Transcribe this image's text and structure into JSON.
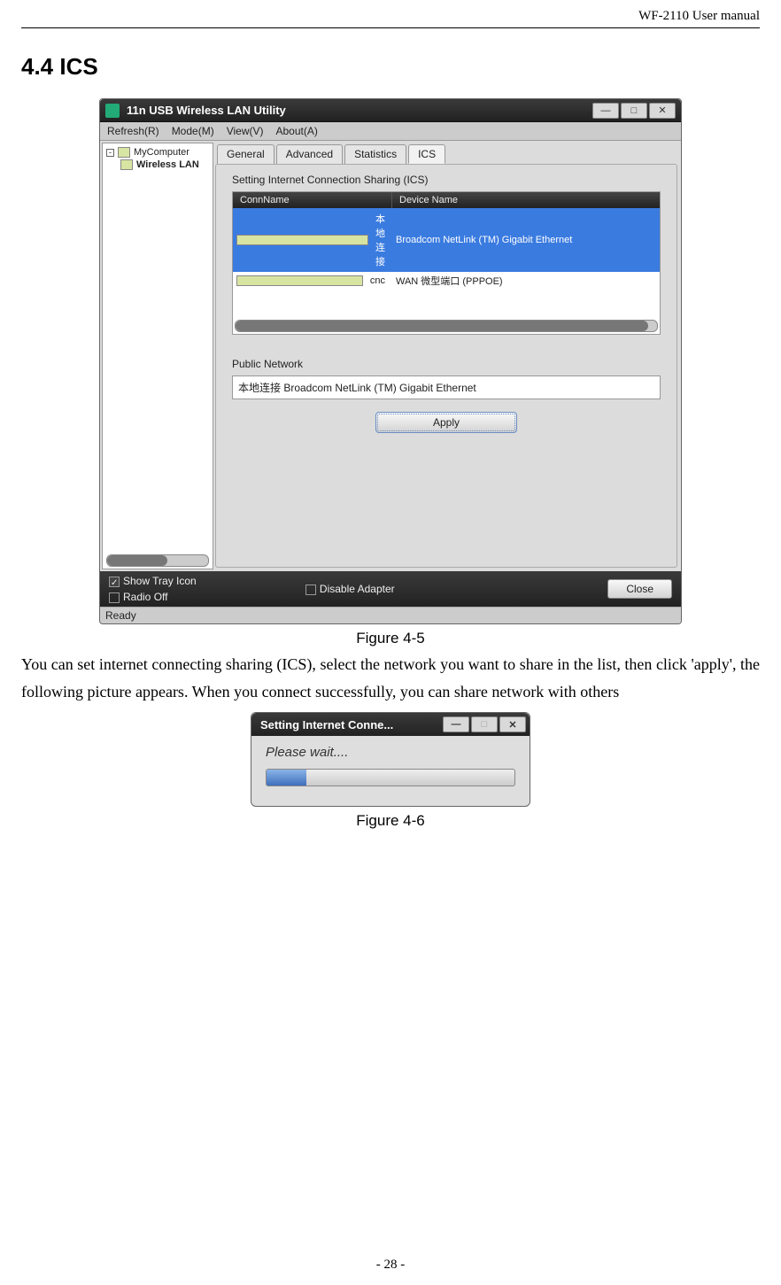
{
  "doc": {
    "header": "WF-2110 User manual",
    "section_heading": "4.4  ICS",
    "fig1_caption": "Figure 4-5",
    "body_paragraph": "You can set internet connecting sharing (ICS), select the network you want to share in the list, then click 'apply', the following picture appears. When you connect successfully, you can share network with others",
    "fig2_caption": "Figure 4-6",
    "page_number": "- 28 -"
  },
  "fig1": {
    "title": "11n USB Wireless LAN Utility",
    "menus": [
      "Refresh(R)",
      "Mode(M)",
      "View(V)",
      "About(A)"
    ],
    "tree": {
      "root": "MyComputer",
      "child": "Wireless LAN"
    },
    "tabs": [
      "General",
      "Advanced",
      "Statistics",
      "ICS"
    ],
    "active_tab_index": 3,
    "panel_heading": "Setting Internet Connection Sharing (ICS)",
    "columns": {
      "conn": "ConnName",
      "dev": "Device Name"
    },
    "rows": [
      {
        "conn": "本地连接",
        "dev": "Broadcom NetLink (TM) Gigabit Ethernet",
        "selected": true
      },
      {
        "conn": "cnc",
        "dev": "WAN 微型端口 (PPPOE)",
        "selected": false
      }
    ],
    "public_network_label": "Public Network",
    "public_network_value": "本地连接 Broadcom NetLink (TM) Gigabit Ethernet",
    "apply_label": "Apply",
    "bottom": {
      "show_tray": "Show Tray Icon",
      "radio_off": "Radio Off",
      "disable_adapter": "Disable Adapter",
      "close": "Close"
    },
    "status": "Ready"
  },
  "fig2": {
    "title": "Setting Internet Conne...",
    "message": "Please wait....",
    "progress_percent": 16
  }
}
